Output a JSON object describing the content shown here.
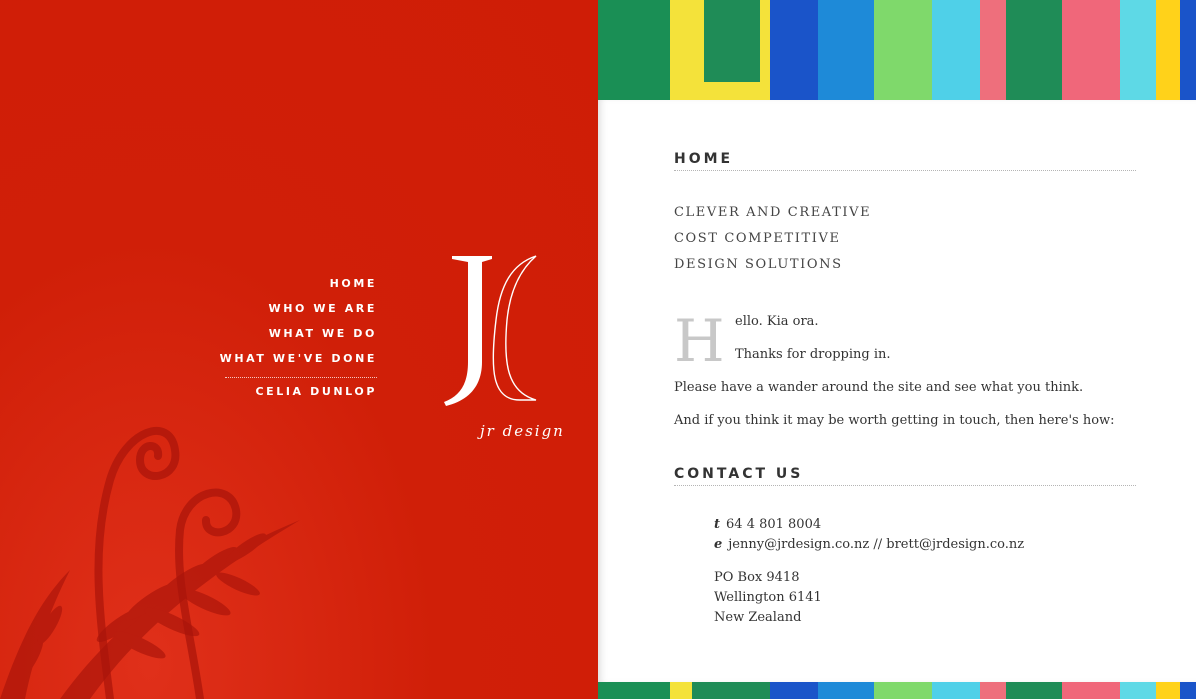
{
  "nav": {
    "items": [
      "HOME",
      "WHO WE ARE",
      "WHAT WE DO",
      "WHAT WE'VE DONE"
    ],
    "sub": "CELIA DUNLOP"
  },
  "brand": {
    "tagline": "jr design"
  },
  "home": {
    "heading": "HOME",
    "taglines": [
      "CLEVER AND CREATIVE",
      "COST COMPETITIVE",
      "DESIGN SOLUTIONS"
    ],
    "dropcap": "H",
    "intro": [
      "ello. Kia ora.",
      "Thanks for dropping in.",
      "Please have a wander around the site and see what you think.",
      "And if you think it may be worth getting in touch, then here's how:"
    ]
  },
  "contact": {
    "heading": "CONTACT US",
    "phone_label": "t",
    "phone": "64 4 801 8004",
    "email_label": "e",
    "email": "jenny@jrdesign.co.nz // brett@jrdesign.co.nz",
    "address": [
      "PO Box 9418",
      "Wellington 6141",
      "New Zealand"
    ]
  },
  "colors": {
    "brand_red": "#cf1d06",
    "stripes": [
      "#1f8c57",
      "#f4e23a",
      "#1a54c9",
      "#1e8ad8",
      "#7fd96b",
      "#4fd0e8",
      "#ee6f7c",
      "#1f8c57",
      "#ffd21a"
    ]
  }
}
